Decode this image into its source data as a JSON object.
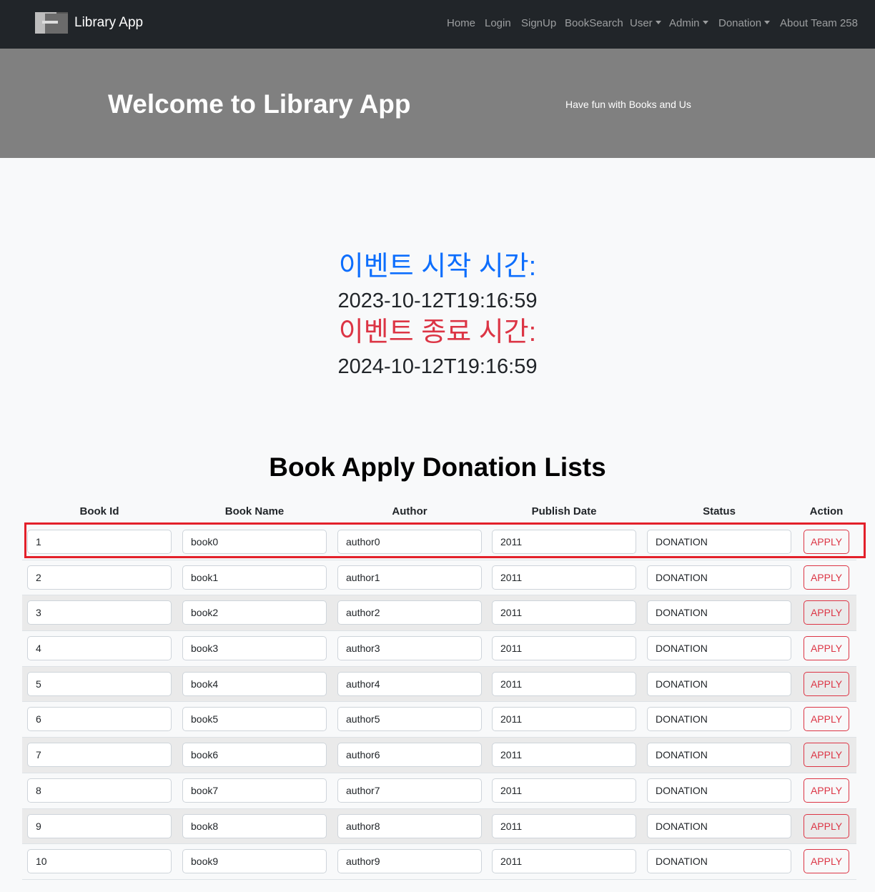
{
  "navbar": {
    "brand": "Library App",
    "items": [
      {
        "label": "Home",
        "active": true,
        "dropdown": false
      },
      {
        "label": "Login",
        "active": false,
        "dropdown": false
      },
      {
        "label": "SignUp",
        "active": false,
        "dropdown": false
      },
      {
        "label": "BookSearch",
        "active": false,
        "dropdown": false
      },
      {
        "label": "User",
        "active": false,
        "dropdown": true
      },
      {
        "label": "Admin",
        "active": false,
        "dropdown": true
      },
      {
        "label": "Donation",
        "active": false,
        "dropdown": true
      },
      {
        "label": "About Team 258",
        "active": true,
        "dropdown": false
      }
    ]
  },
  "hero": {
    "title": "Welcome to Library App",
    "subtitle": "Have fun with Books and Us"
  },
  "event": {
    "start_label": "이벤트 시작 시간:",
    "start_value": "2023-10-12T19:16:59",
    "end_label": "이벤트 종료 시간:",
    "end_value": "2024-10-12T19:16:59"
  },
  "list": {
    "title": "Book Apply Donation Lists",
    "columns": [
      "Book Id",
      "Book Name",
      "Author",
      "Publish Date",
      "Status",
      "Action"
    ],
    "rows": [
      {
        "id": "1",
        "name": "book0",
        "author": "author0",
        "date": "2011",
        "status": "DONATION",
        "action": "APPLY"
      },
      {
        "id": "2",
        "name": "book1",
        "author": "author1",
        "date": "2011",
        "status": "DONATION",
        "action": "APPLY"
      },
      {
        "id": "3",
        "name": "book2",
        "author": "author2",
        "date": "2011",
        "status": "DONATION",
        "action": "APPLY"
      },
      {
        "id": "4",
        "name": "book3",
        "author": "author3",
        "date": "2011",
        "status": "DONATION",
        "action": "APPLY"
      },
      {
        "id": "5",
        "name": "book4",
        "author": "author4",
        "date": "2011",
        "status": "DONATION",
        "action": "APPLY"
      },
      {
        "id": "6",
        "name": "book5",
        "author": "author5",
        "date": "2011",
        "status": "DONATION",
        "action": "APPLY"
      },
      {
        "id": "7",
        "name": "book6",
        "author": "author6",
        "date": "2011",
        "status": "DONATION",
        "action": "APPLY"
      },
      {
        "id": "8",
        "name": "book7",
        "author": "author7",
        "date": "2011",
        "status": "DONATION",
        "action": "APPLY"
      },
      {
        "id": "9",
        "name": "book8",
        "author": "author8",
        "date": "2011",
        "status": "DONATION",
        "action": "APPLY"
      },
      {
        "id": "10",
        "name": "book9",
        "author": "author9",
        "date": "2011",
        "status": "DONATION",
        "action": "APPLY"
      }
    ]
  },
  "colors": {
    "navbar_bg": "#212529",
    "hero_bg": "#808080",
    "start_label": "#0d6efd",
    "end_label": "#dc3545",
    "apply_button": "#dc3545",
    "highlight": "#e3202a"
  }
}
